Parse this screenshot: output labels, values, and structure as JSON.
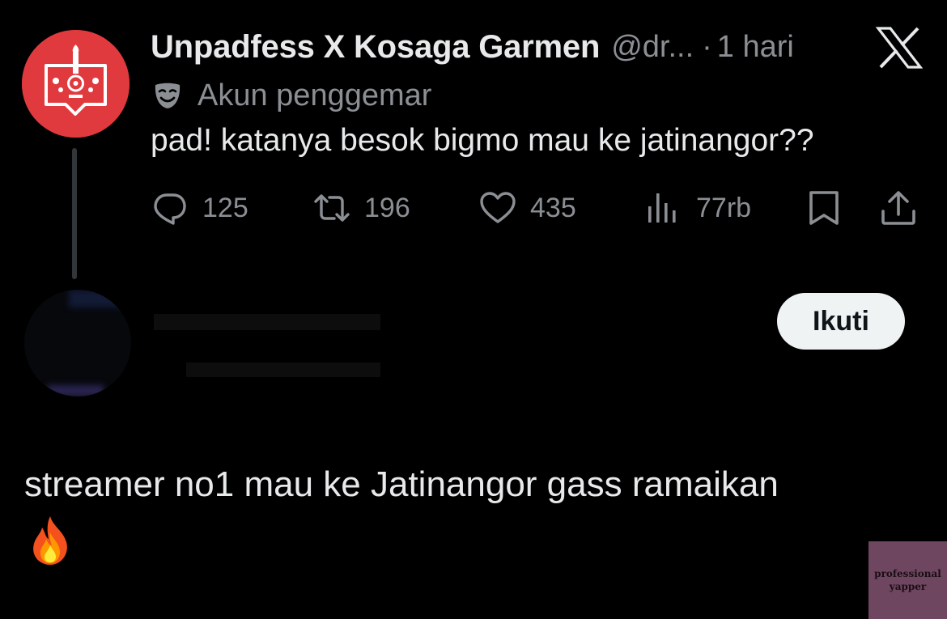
{
  "tweet": {
    "display_name": "Unpadfess X Kosaga Garmen",
    "handle": "@dr...",
    "separator": "·",
    "time": "1 hari",
    "badge_icon": "theater-mask-icon",
    "badge_label": "Akun penggemar",
    "text": "pad! katanya besok bigmo mau ke jatinangor??",
    "avatar_color": "#e03a3e",
    "actions": {
      "reply_count": "125",
      "retweet_count": "196",
      "like_count": "435",
      "views_count": "77rb"
    }
  },
  "platform_logo": "x-logo-icon",
  "reply": {
    "follow_label": "Ikuti",
    "text": "streamer no1 mau ke Jatinangor gass ramaikan",
    "emoji_icon": "fire-emoji-icon"
  },
  "watermark": {
    "line1": "professional",
    "line2": "yapper",
    "color": "#6e4660"
  },
  "colors": {
    "background": "#000000",
    "primary_text": "#e7e9ea",
    "secondary_text": "#8b8f94",
    "follow_button_bg": "#eff3f4"
  }
}
